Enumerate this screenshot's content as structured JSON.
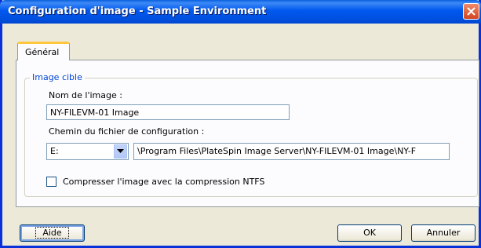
{
  "window": {
    "title": "Configuration d'image - Sample Environment"
  },
  "tabs": [
    {
      "label": "Général"
    }
  ],
  "group": {
    "legend": "Image cible"
  },
  "image_name": {
    "label": "Nom de l'image :",
    "value": "NY-FILEVM-01 Image"
  },
  "config_path": {
    "label": "Chemin du fichier de configuration :",
    "drive": "E:",
    "path": "\\Program Files\\PlateSpin Image Server\\NY-FILEVM-01 Image\\NY-F"
  },
  "compress": {
    "label": "Compresser l'image avec la compression NTFS",
    "checked": false
  },
  "buttons": {
    "help": "Aide",
    "ok": "OK",
    "cancel": "Annuler"
  },
  "icons": {
    "close": "close-icon",
    "dropdown": "chevron-down-icon"
  },
  "colors": {
    "titlebar": "#0058ee",
    "legend": "#0046d5",
    "tab_highlight": "#ffc83c"
  }
}
